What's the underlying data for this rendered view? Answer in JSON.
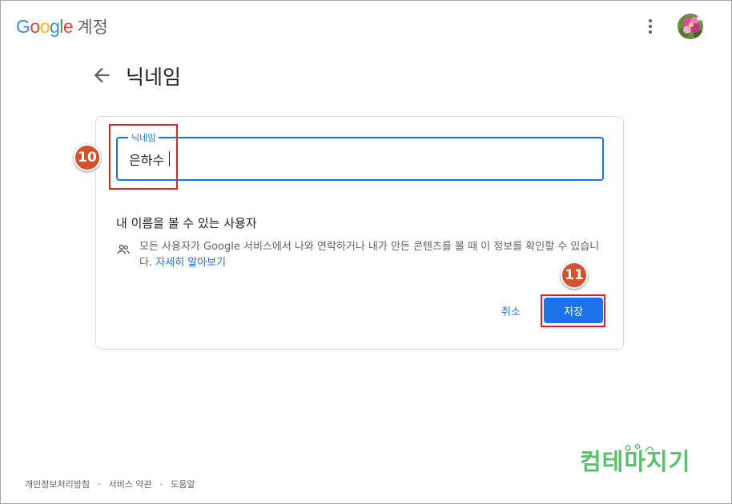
{
  "header": {
    "logo_letters": [
      "G",
      "o",
      "o",
      "g",
      "l",
      "e"
    ],
    "logo_colors": [
      "#4285f4",
      "#ea4335",
      "#fbbc05",
      "#4285f4",
      "#34a853",
      "#ea4335"
    ],
    "product": "계정",
    "more_icon": "more-vert-icon",
    "avatar_icon": "flower-avatar"
  },
  "page": {
    "back_icon": "arrow-back-icon",
    "title": "닉네임"
  },
  "form": {
    "field_label": "닉네임",
    "field_value": "은하수",
    "visibility_heading": "내 이름을 볼 수 있는 사용자",
    "people_icon": "people-icon",
    "description": "모든 사용자가 Google 서비스에서 나와 연락하거나 내가 만든 콘텐츠를 볼 때 이 정보를 확인할 수 있습니다.",
    "learn_more": "자세히 알아보기",
    "cancel_label": "취소",
    "save_label": "저장"
  },
  "annotations": {
    "step_a": "10",
    "step_b": "11",
    "highlight_color": "#e52020",
    "badge_color": "#d4512b"
  },
  "footer": {
    "links": [
      "개인정보처리방침",
      "서비스 약관",
      "도움말"
    ],
    "separator": "·"
  },
  "watermark": {
    "text": "컴테마지기"
  },
  "colors": {
    "accent": "#1a73e8",
    "secondary_text": "#5f6368"
  }
}
